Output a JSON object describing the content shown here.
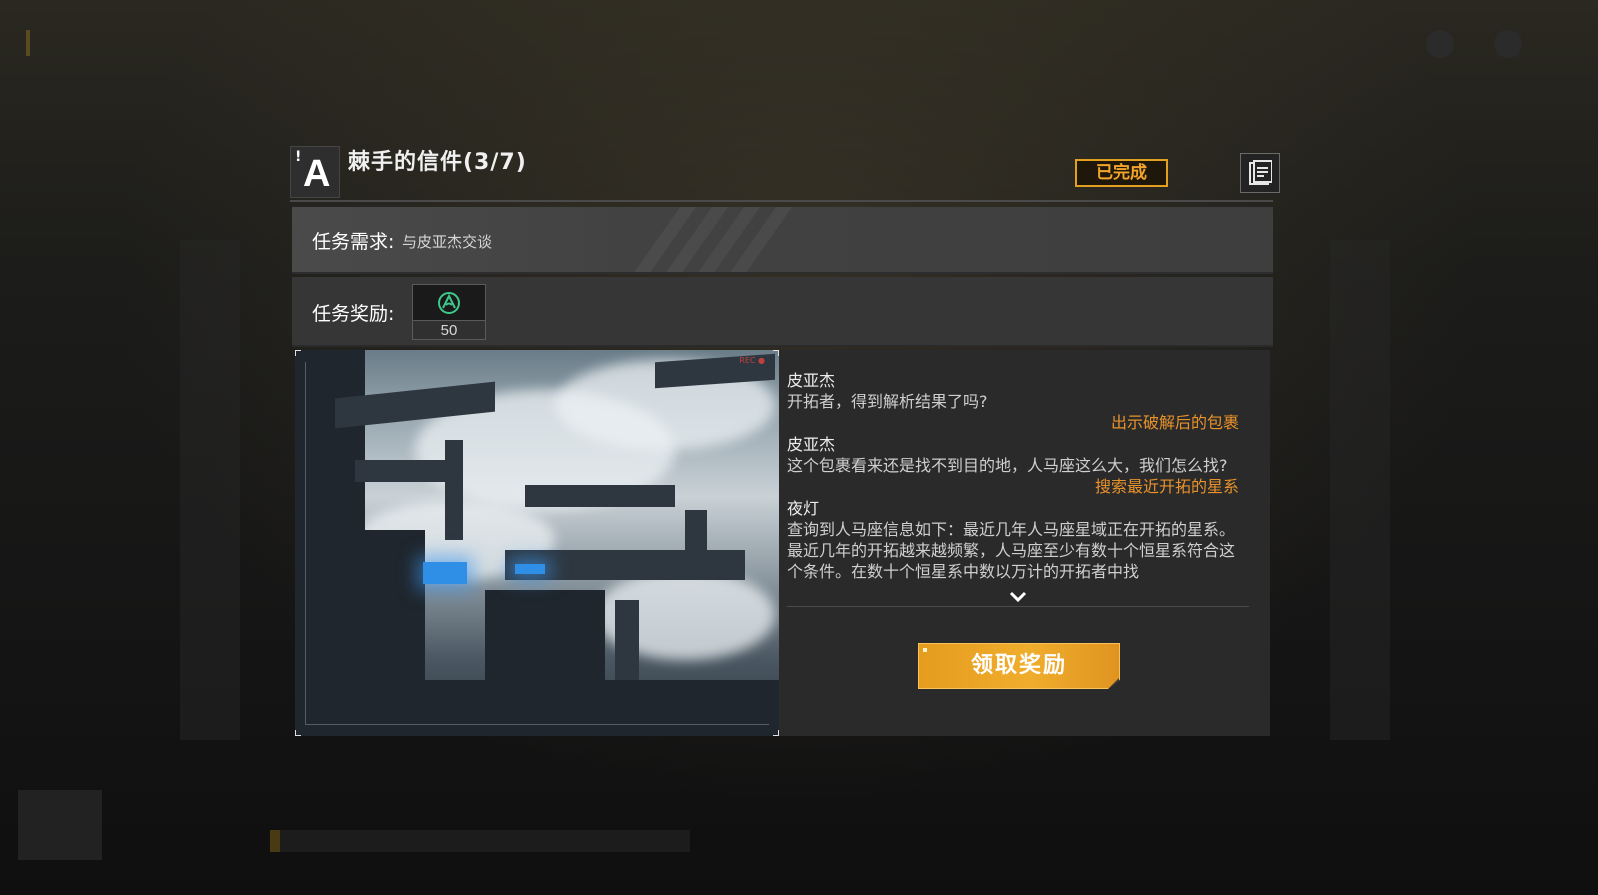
{
  "quest": {
    "grade_letter": "A",
    "grade_mark": "!",
    "title": "棘手的信件(3/7)",
    "status": "已完成"
  },
  "requirement": {
    "label": "任务需求:",
    "value": "与皮亚杰交谈"
  },
  "reward": {
    "label": "任务奖励:",
    "items": [
      {
        "icon": "pioneer-emblem-icon",
        "amount": "50"
      }
    ]
  },
  "dialogue": [
    {
      "speaker": "皮亚杰",
      "text": "开拓者，得到解析结果了吗?"
    },
    {
      "choice": "出示破解后的包裹"
    },
    {
      "speaker": "皮亚杰",
      "text": "这个包裹看来还是找不到目的地，人马座这么大，我们怎么找?"
    },
    {
      "choice": "搜索最近开拓的星系"
    },
    {
      "speaker": "夜灯",
      "text": "查询到人马座信息如下：最近几年人马座星域正在开拓的星系。最近几年的开拓越来越频繁，人马座至少有数十个恒星系符合这个条件。在数十个恒星系中数以万计的开拓者中找"
    }
  ],
  "buttons": {
    "claim_reward": "领取奖励"
  },
  "icons": {
    "quest_log": "document-icon",
    "more": "chevron-down-icon"
  },
  "colors": {
    "accent_orange": "#f0ad2c",
    "choice_orange": "#e8922c",
    "reward_icon_green": "#3ec98a"
  }
}
